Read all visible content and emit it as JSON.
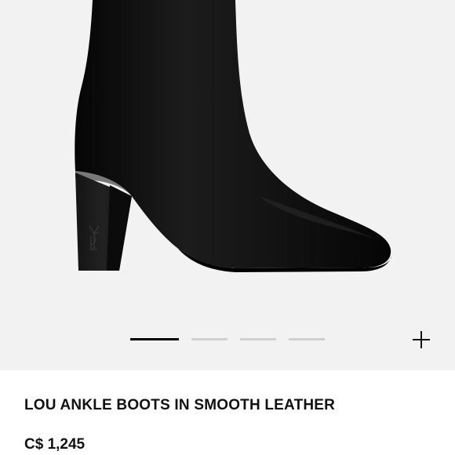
{
  "product": {
    "title": "LOU ANKLE BOOTS IN SMOOTH LEATHER",
    "price": "C$ 1,245",
    "image_description": "black smooth leather ankle boot with block heel"
  },
  "gallery": {
    "slide_count": 4,
    "active_slide": 1,
    "zoom_icon": "plus-icon"
  },
  "colors": {
    "background": "#f2f2f2",
    "boot": "#0c0c0c",
    "indicator_active": "#000000",
    "indicator_inactive": "#d0d0d0",
    "text": "#111111"
  }
}
